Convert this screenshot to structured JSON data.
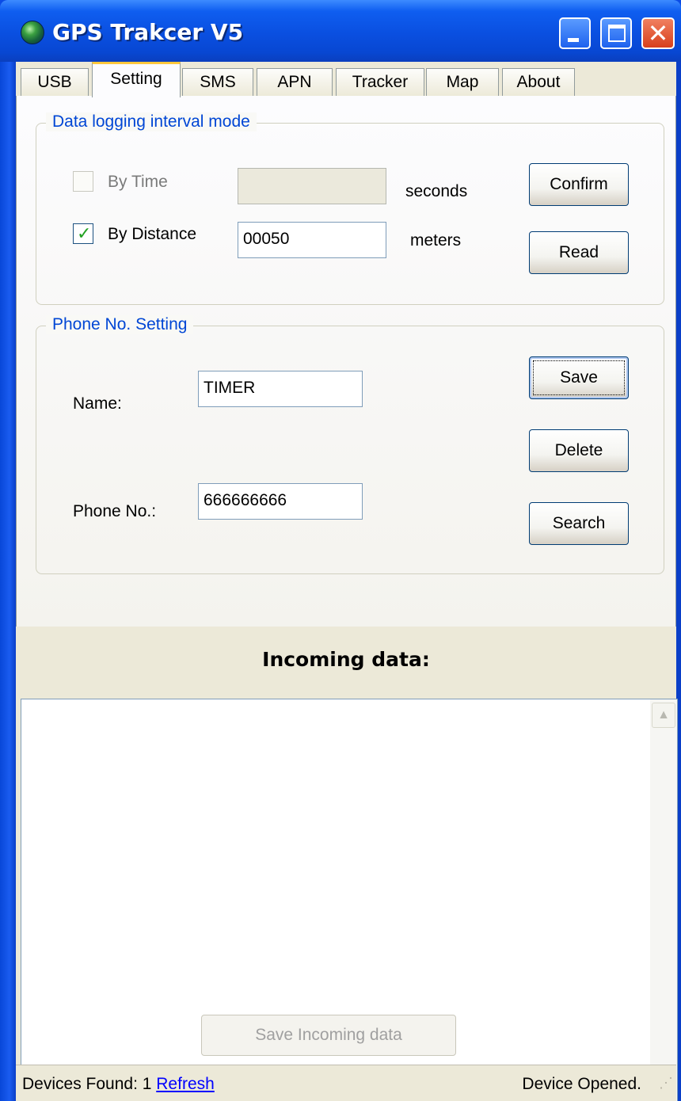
{
  "window": {
    "title": "GPS Trakcer V5",
    "close_glyph": "✕"
  },
  "tabs": [
    {
      "label": "USB"
    },
    {
      "label": "Setting",
      "active": true
    },
    {
      "label": "SMS"
    },
    {
      "label": "APN"
    },
    {
      "label": "Tracker"
    },
    {
      "label": "Map"
    },
    {
      "label": "About"
    }
  ],
  "logging": {
    "title": "Data logging interval mode",
    "by_time_label": "By Time",
    "by_time_checked": false,
    "by_time_value": "",
    "seconds_unit": "seconds",
    "by_distance_label": "By Distance",
    "by_distance_checked": true,
    "by_distance_value": "00050",
    "meters_unit": "meters",
    "confirm_label": "Confirm",
    "read_label": "Read"
  },
  "phone": {
    "title": "Phone No. Setting",
    "name_label": "Name:",
    "name_value": "TIMER",
    "phone_label": "Phone No.:",
    "phone_value": "666666666",
    "save_label": "Save",
    "delete_label": "Delete",
    "search_label": "Search"
  },
  "incoming": {
    "title": "Incoming data:",
    "content": "",
    "save_label": "Save Incoming data",
    "scroll_up": "▲",
    "scroll_down": "▼"
  },
  "status": {
    "devices_found": "Devices Found:  1",
    "refresh_label": "Refresh",
    "state": "Device Opened."
  },
  "icons": [
    "globe-icon",
    "minimize-icon",
    "maximize-icon",
    "close-icon",
    "check-icon",
    "resize-grip-icon"
  ],
  "colors": {
    "titlebar": "#0a4fe0",
    "client_bg": "#ece9d8",
    "group_title": "#0046d5",
    "active_tab_accent": "#ffc73c",
    "link": "#0000ff"
  }
}
